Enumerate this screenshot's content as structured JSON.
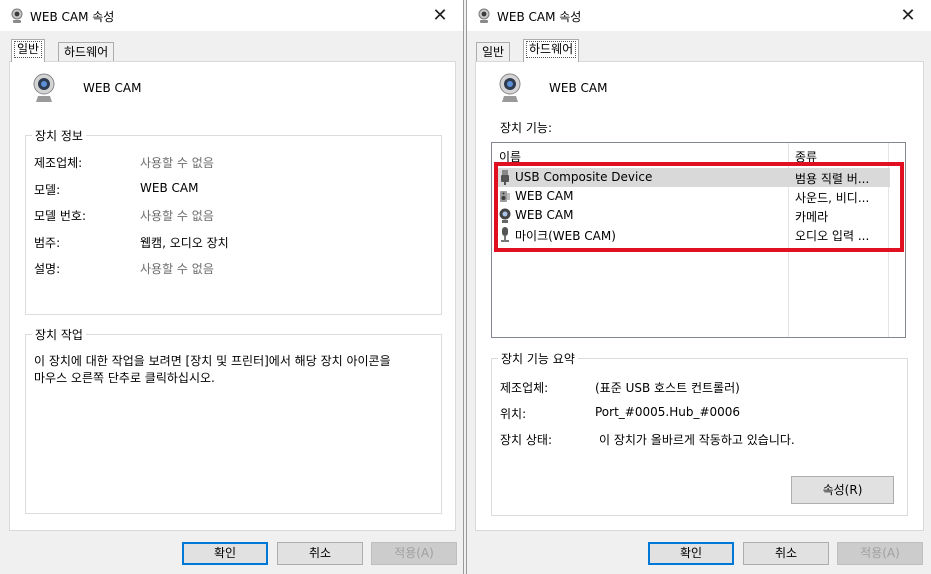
{
  "colors": {
    "highlight": "#e01020",
    "default_button_border": "#0078d7"
  },
  "left": {
    "title": "WEB CAM 속성",
    "tabs": [
      {
        "label": "일반",
        "active": true
      },
      {
        "label": "하드웨어",
        "active": false
      }
    ],
    "device_name": "WEB CAM",
    "info_group": {
      "title": "장치 정보",
      "rows": [
        {
          "label": "제조업체:",
          "value": "사용할 수 없음"
        },
        {
          "label": "모델:",
          "value": "WEB CAM"
        },
        {
          "label": "모델 번호:",
          "value": "사용할 수 없음"
        },
        {
          "label": "범주:",
          "value": "웹캠, 오디오 장치"
        },
        {
          "label": "설명:",
          "value": "사용할 수 없음"
        }
      ]
    },
    "tasks_group": {
      "title": "장치 작업",
      "text_line1": "이 장치에 대한 작업을 보려면 [장치 및 프린터]에서 해당 장치 아이콘을",
      "text_line2": "마우스 오른쪽 단추로 클릭하십시오."
    },
    "buttons": {
      "ok": "확인",
      "cancel": "취소",
      "apply": "적용(A)"
    }
  },
  "right": {
    "title": "WEB CAM 속성",
    "tabs": [
      {
        "label": "일반",
        "active": false
      },
      {
        "label": "하드웨어",
        "active": true
      }
    ],
    "device_name": "WEB CAM",
    "functions_label": "장치 기능:",
    "list": {
      "columns": [
        "이름",
        "종류"
      ],
      "rows": [
        {
          "name": "USB Composite Device",
          "type": "범용 직렬 버...",
          "icon": "usb-plug-icon",
          "selected": true
        },
        {
          "name": "WEB CAM",
          "type": "사운드, 비디...",
          "icon": "speaker-icon",
          "selected": false
        },
        {
          "name": "WEB CAM",
          "type": "카메라",
          "icon": "webcam-icon",
          "selected": false
        },
        {
          "name": "마이크(WEB CAM)",
          "type": "오디오 입력 ...",
          "icon": "microphone-icon",
          "selected": false
        }
      ]
    },
    "summary_group": {
      "title": "장치 기능 요약",
      "rows": [
        {
          "label": "제조업체:",
          "value": "(표준 USB 호스트 컨트롤러)"
        },
        {
          "label": "위치:",
          "value": "Port_#0005.Hub_#0006"
        },
        {
          "label": "장치 상태:",
          "value": "이 장치가 올바르게 작동하고 있습니다."
        }
      ],
      "properties_button": "속성(R)"
    },
    "buttons": {
      "ok": "확인",
      "cancel": "취소",
      "apply": "적용(A)"
    }
  }
}
